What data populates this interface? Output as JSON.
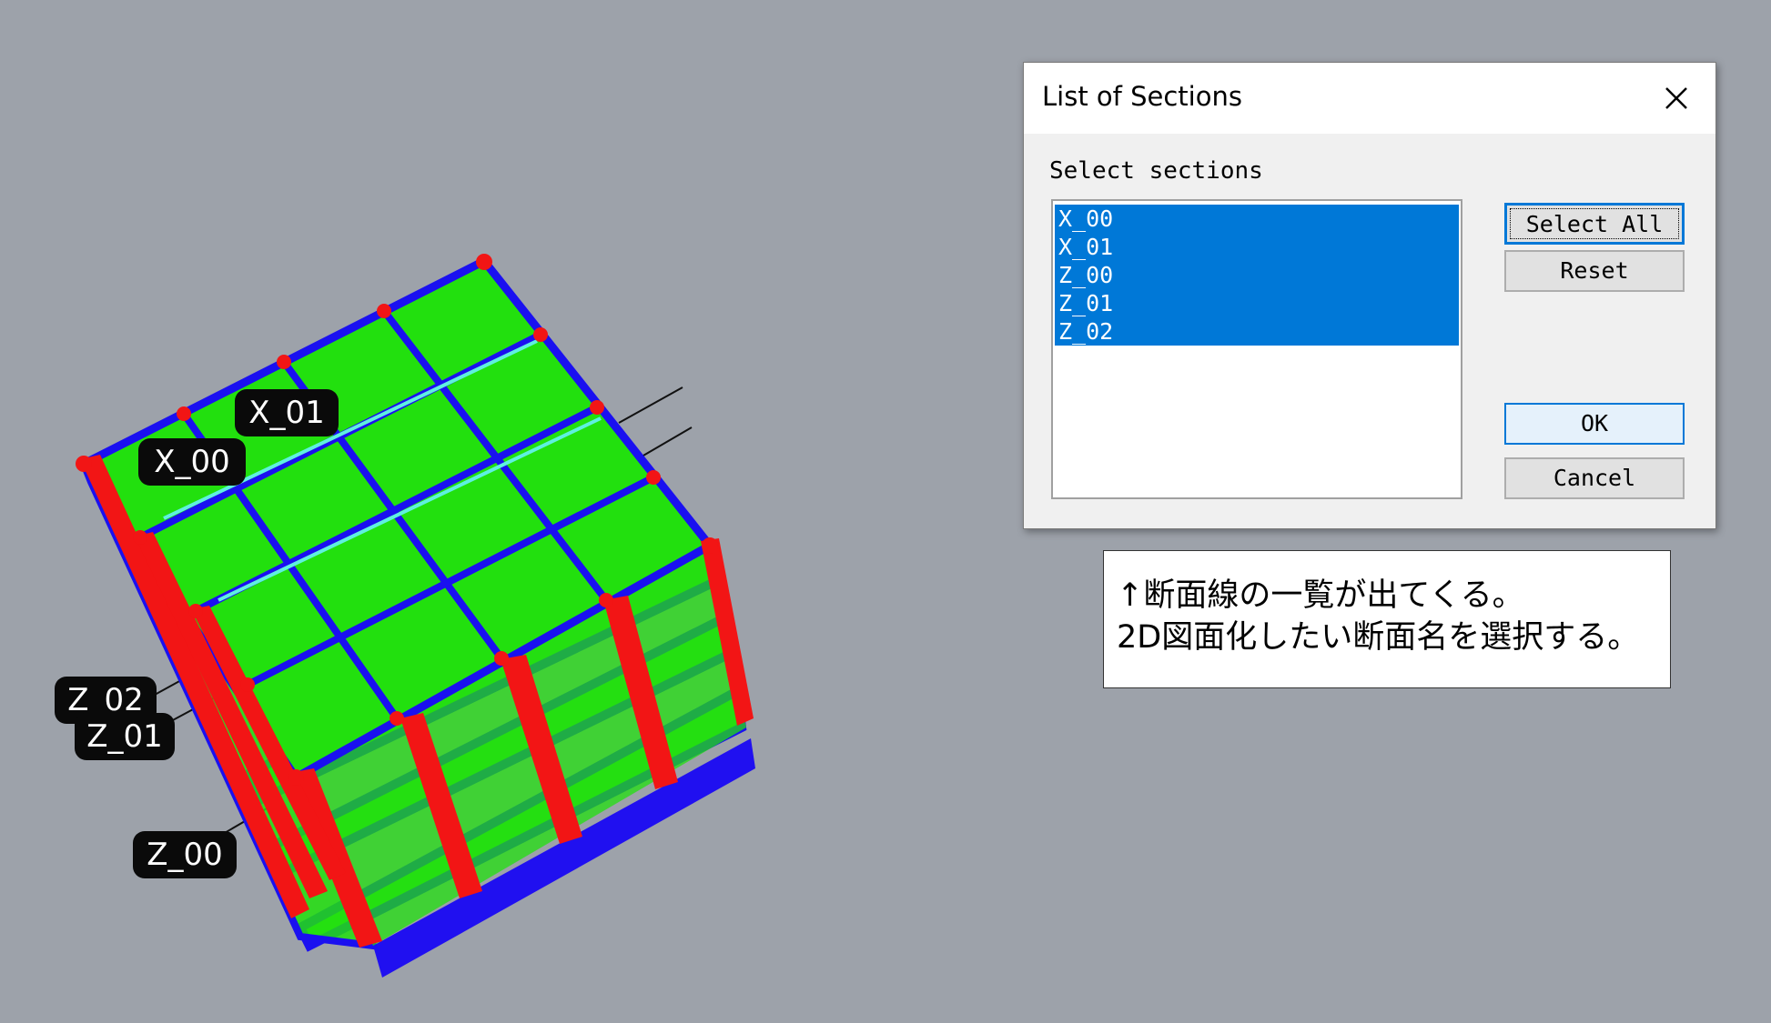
{
  "dialog": {
    "title": "List of Sections",
    "prompt": "Select sections",
    "sections": [
      "X_00",
      "X_01",
      "Z_00",
      "Z_01",
      "Z_02"
    ],
    "selected": [
      "X_00",
      "X_01",
      "Z_00",
      "Z_01",
      "Z_02"
    ],
    "buttons": {
      "select_all": "Select All",
      "reset": "Reset",
      "ok": "OK",
      "cancel": "Cancel"
    }
  },
  "note": {
    "line1": "↑断面線の一覧が出てくる。",
    "line2": "2D図面化したい断面名を選択する。"
  },
  "section_tags": {
    "x01": "X_01",
    "x00": "X_00",
    "z02": "Z_02",
    "z01": "Z_01",
    "z00": "Z_00"
  },
  "colors": {
    "background": "#9da2aa",
    "slab": "#22e00e",
    "beam": "#1a10f0",
    "column": "#f21515",
    "selection": "#0078d7"
  }
}
